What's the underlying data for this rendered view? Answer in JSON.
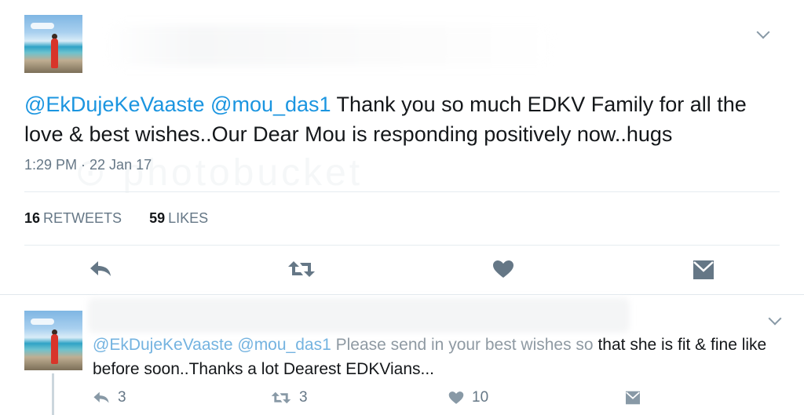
{
  "main_tweet": {
    "mention_1": "@EkDujeKeVaaste",
    "mention_2": "@mou_das1",
    "text": " Thank you so much EDKV Family for all the love & best wishes..Our Dear Mou is responding positively now..hugs",
    "timestamp": "1:29 PM · 22 Jan 17",
    "retweet_count": "16",
    "retweet_label": "RETWEETS",
    "like_count": "59",
    "like_label": "LIKES"
  },
  "reply_tweet": {
    "mention_1": "@EkDujeKeVaaste",
    "mention_2": "@mou_das1",
    "text_faded": " Please send in your best wishes so",
    "text": " that she is fit & fine like before soon..Thanks a lot Dearest EDKVians...",
    "reply_count": "3",
    "retweet_count": "3",
    "like_count": "10"
  },
  "icons": {
    "reply": "reply-icon",
    "retweet": "retweet-icon",
    "like": "heart-icon",
    "dm": "envelope-icon",
    "more": "chevron-down-icon"
  },
  "colors": {
    "link": "#1b95e0",
    "muted": "#657786",
    "divider": "#e6ecf0"
  }
}
